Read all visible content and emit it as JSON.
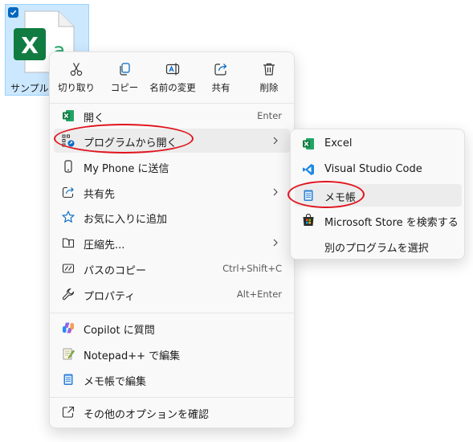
{
  "file": {
    "name": "サンプル.x",
    "icon": "excel-file-icon",
    "selected": true
  },
  "quick_actions": [
    {
      "label": "切り取り",
      "icon": "scissors-icon"
    },
    {
      "label": "コピー",
      "icon": "copy-icon"
    },
    {
      "label": "名前の変更",
      "icon": "rename-icon"
    },
    {
      "label": "共有",
      "icon": "share-icon"
    },
    {
      "label": "削除",
      "icon": "trash-icon"
    }
  ],
  "menu": {
    "items": [
      {
        "label": "開く",
        "accelerator": "Enter",
        "icon": "excel-icon"
      },
      {
        "label": "プログラムから開く",
        "icon": "open-with-icon",
        "submenu": true,
        "highlighted": true
      },
      {
        "label": "My Phone に送信",
        "icon": "phone-icon"
      },
      {
        "label": "共有先",
        "icon": "share-to-icon",
        "submenu": true
      },
      {
        "label": "お気に入りに追加",
        "icon": "star-icon"
      },
      {
        "label": "圧縮先...",
        "icon": "zip-folder-icon",
        "submenu": true
      },
      {
        "label": "パスのコピー",
        "accelerator": "Ctrl+Shift+C",
        "icon": "copy-path-icon"
      },
      {
        "label": "プロパティ",
        "accelerator": "Alt+Enter",
        "icon": "wrench-icon"
      },
      {
        "label": "Copilot に質問",
        "icon": "copilot-icon"
      },
      {
        "label": "Notepad++ で編集",
        "icon": "notepadpp-icon"
      },
      {
        "label": "メモ帳で編集",
        "icon": "notepad-icon"
      },
      {
        "label": "その他のオプションを確認",
        "icon": "more-options-icon"
      }
    ]
  },
  "submenu": {
    "items": [
      {
        "label": "Excel",
        "icon": "excel-icon"
      },
      {
        "label": "Visual Studio Code",
        "icon": "vscode-icon"
      },
      {
        "label": "メモ帳",
        "icon": "notepad-icon",
        "highlighted": true
      },
      {
        "label": "Microsoft Store を検索する",
        "icon": "store-icon"
      },
      {
        "label": "別のプログラムを選択",
        "icon": ""
      }
    ]
  },
  "annotation_color": "#e0141e",
  "excel_green": "#107c41",
  "accent": "#0067c0"
}
